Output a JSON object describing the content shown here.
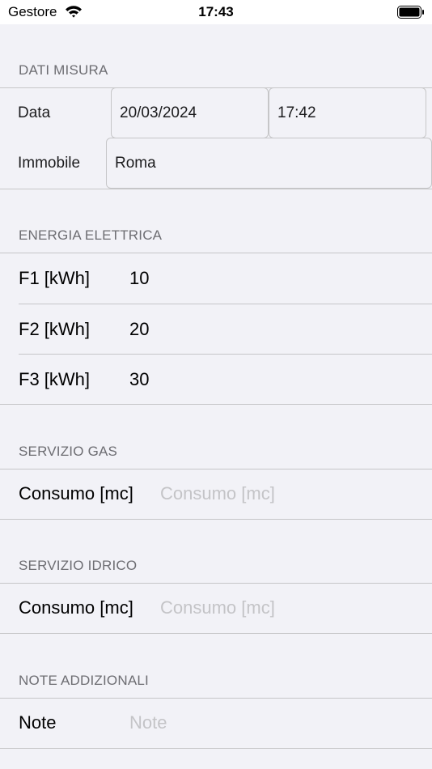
{
  "status": {
    "carrier": "Gestore",
    "time": "17:43"
  },
  "sections": {
    "dati_misura": {
      "header": "DATI MISURA",
      "data_label": "Data",
      "date_value": "20/03/2024",
      "time_value": "17:42",
      "immobile_label": "Immobile",
      "immobile_value": "Roma"
    },
    "energia": {
      "header": "ENERGIA ELETTRICA",
      "rows": [
        {
          "label": "F1 [kWh]",
          "value": "10"
        },
        {
          "label": "F2 [kWh]",
          "value": "20"
        },
        {
          "label": "F3 [kWh]",
          "value": "30"
        }
      ]
    },
    "gas": {
      "header": "SERVIZIO GAS",
      "label": "Consumo [mc]",
      "placeholder": "Consumo [mc]"
    },
    "idrico": {
      "header": "SERVIZIO IDRICO",
      "label": "Consumo [mc]",
      "placeholder": "Consumo [mc]"
    },
    "note": {
      "header": "NOTE ADDIZIONALI",
      "label": "Note",
      "placeholder": "Note"
    }
  }
}
